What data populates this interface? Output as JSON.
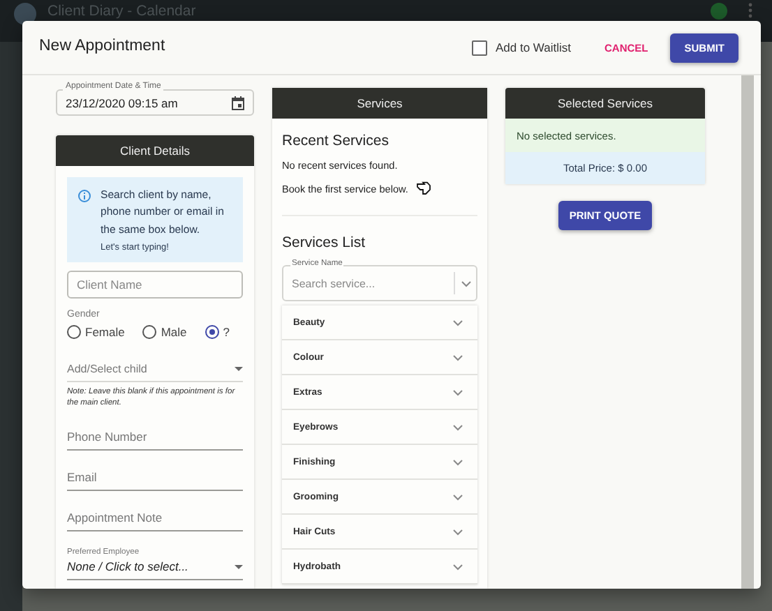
{
  "app": {
    "title": "Client Diary - Calendar"
  },
  "dialog": {
    "title": "New Appointment",
    "waitlist": {
      "label": "Add to Waitlist",
      "checked": false
    },
    "buttons": [
      {
        "label": "CANCEL",
        "kind": "text"
      },
      {
        "label": "SUBMIT",
        "kind": "primary"
      }
    ]
  },
  "appointment_date": {
    "label": "Appointment Date & Time",
    "value": "23/12/2020 09:15 am"
  },
  "client_details": {
    "title": "Client Details",
    "info": {
      "text": "Search client by name, phone number or email in the same box below.",
      "hint": "Let's start typing!"
    },
    "client_name": {
      "placeholder": "Client Name"
    },
    "gender": {
      "label": "Gender",
      "options": [
        {
          "label": "Female",
          "selected": false
        },
        {
          "label": "Male",
          "selected": false
        },
        {
          "label": "?",
          "selected": true
        }
      ]
    },
    "child": {
      "placeholder": "Add/Select child",
      "note": "Note: Leave this blank if this appointment is for the main client."
    },
    "fields": [
      {
        "placeholder": "Phone Number"
      },
      {
        "placeholder": "Email"
      },
      {
        "placeholder": "Appointment Note"
      }
    ],
    "preferred_employee": {
      "label": "Preferred Employee",
      "value": "None / Click to select..."
    }
  },
  "services": {
    "title": "Services",
    "recent": {
      "heading": "Recent Services",
      "lines": [
        "No recent services found.",
        "Book the first service below."
      ]
    },
    "list": {
      "heading": "Services List",
      "search": {
        "label": "Service Name",
        "placeholder": "Search service..."
      },
      "categories": [
        {
          "name": "Beauty",
          "expanded": false
        },
        {
          "name": "Colour",
          "expanded": false
        },
        {
          "name": "Extras",
          "expanded": false
        },
        {
          "name": "Eyebrows",
          "expanded": false
        },
        {
          "name": "Finishing",
          "expanded": false
        },
        {
          "name": "Grooming",
          "expanded": false
        },
        {
          "name": "Hair Cuts",
          "expanded": false
        },
        {
          "name": "Hydrobath",
          "expanded": false
        }
      ]
    }
  },
  "selected_services": {
    "title": "Selected Services",
    "empty": "No selected services.",
    "total": "Total Price: $ 0.00",
    "print_button": "PRINT QUOTE"
  }
}
